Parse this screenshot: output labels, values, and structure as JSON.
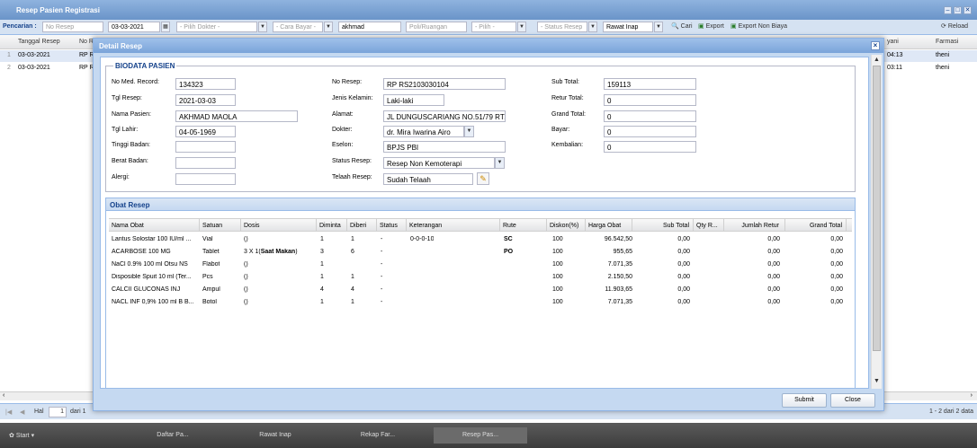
{
  "bg": {
    "title": "Resep Pasien Registrasi",
    "search_label": "Pencarian :",
    "search_placeholder": "No Resep",
    "date_value": "03-03-2021",
    "dokter_placeholder": "- Pilih Dokter -",
    "carabayar_placeholder": "- Cara Bayar -",
    "name_value": "akhmad",
    "poli_placeholder": "Poli/Ruangan",
    "pilih_placeholder": "- Pilih -",
    "status_placeholder": "- Status Resep",
    "rawat_value": "Rawat Inap",
    "cari_label": "Cari",
    "export_label": "Export",
    "export_non_label": "Export Non Biaya",
    "reload_label": "Reload",
    "columns": [
      "Tanggal Resep",
      "No R",
      "yani",
      "Farmasi"
    ],
    "rows": [
      {
        "num": "1",
        "date": "03-03-2021",
        "nor": "RP R",
        "time": "04:13",
        "farmasi": "theni"
      },
      {
        "num": "2",
        "date": "03-03-2021",
        "nor": "RP R",
        "time": "03:11",
        "farmasi": "theni"
      }
    ],
    "pager_hal": "Hal",
    "pager_page": "1",
    "pager_of": "dari 1",
    "pager_info": "1 - 2 dari 2 data"
  },
  "taskbar": {
    "start": "Start",
    "tasks": [
      "Daftar Pa...",
      "Rawat Inap",
      "Rekap Far...",
      "Resep Pas..."
    ]
  },
  "dialog": {
    "title": "Detail Resep",
    "submit": "Submit",
    "close": "Close"
  },
  "bio": {
    "legend": "BIODATA PASIEN",
    "labels": {
      "nomed": "No Med. Record:",
      "tglresep": "Tgl Resep:",
      "nama": "Nama Pasien:",
      "tgllahir": "Tgl Lahir:",
      "tinggi": "Tinggi Badan:",
      "berat": "Berat Badan:",
      "alergi": "Alergi:",
      "noresep": "No Resep:",
      "jk": "Jenis Kelamin:",
      "alamat": "Alamat:",
      "dokter": "Dokter:",
      "eselon": "Eselon:",
      "statusresep": "Status Resep:",
      "telaah": "Telaah Resep:",
      "subtotal": "Sub Total:",
      "retur": "Retur Total:",
      "grand": "Grand Total:",
      "bayar": "Bayar:",
      "kembalian": "Kembalian:"
    },
    "values": {
      "nomed": "134323",
      "tglresep": "2021-03-03",
      "nama": "AKHMAD MAOLA",
      "tgllahir": "04-05-1969",
      "tinggi": "",
      "berat": "",
      "alergi": "",
      "noresep": "RP RS2103030104",
      "jk": "Laki-laki",
      "alamat": "JL DUNGUSCARIANG NO.51/79 RT/",
      "dokter": "dr. Mira Iwarina Airo",
      "eselon": "BPJS PBI",
      "statusresep": "Resep Non Kemoterapi",
      "telaah": "Sudah Telaah",
      "subtotal": "159113",
      "retur": "0",
      "grand": "0",
      "bayar": "0",
      "kembalian": "0"
    }
  },
  "obat": {
    "title": "Obat Resep",
    "columns": [
      "Nama Obat",
      "Satuan",
      "Dosis",
      "Diminta",
      "Diberi",
      "Status",
      "Keterangan",
      "Rute",
      "Diskon(%)",
      "Harga Obat",
      "Sub Total",
      "Qty R...",
      "Jumlah Retur",
      "Grand Total"
    ],
    "rows": [
      {
        "nama": "Lantus Solostar 100 IU/ml ...",
        "satuan": "Vial",
        "dosis_a": "()",
        "dosis_b": "",
        "diminta": "1",
        "diberi": "1",
        "status": "-",
        "ket": "0-0-0-10",
        "rute": "SC",
        "diskon": "100",
        "harga": "96.542,50",
        "sub": "0,00",
        "qty": "",
        "retur": "0,00",
        "grand": "0,00"
      },
      {
        "nama": "ACARBOSE 100 MG",
        "satuan": "Tablet",
        "dosis_a": "3 X 1(",
        "dosis_b": "Saat Makan",
        "dosis_c": ")",
        "diminta": "3",
        "diberi": "6",
        "status": "-",
        "ket": "",
        "rute": "PO",
        "diskon": "100",
        "harga": "955,65",
        "sub": "0,00",
        "qty": "",
        "retur": "0,00",
        "grand": "0,00"
      },
      {
        "nama": "NaCl 0.9% 100 ml Otsu NS",
        "satuan": "Flabot",
        "dosis_a": "()",
        "dosis_b": "",
        "diminta": "1",
        "diberi": "",
        "status": "-",
        "ket": "",
        "rute": "",
        "diskon": "100",
        "harga": "7.071,35",
        "sub": "0,00",
        "qty": "",
        "retur": "0,00",
        "grand": "0,00"
      },
      {
        "nama": "Disposible Spuit 10 ml (Ter...",
        "satuan": "Pcs",
        "dosis_a": "()",
        "dosis_b": "",
        "diminta": "1",
        "diberi": "1",
        "status": "-",
        "ket": "",
        "rute": "",
        "diskon": "100",
        "harga": "2.150,50",
        "sub": "0,00",
        "qty": "",
        "retur": "0,00",
        "grand": "0,00"
      },
      {
        "nama": "CALCII GLUCONAS INJ",
        "satuan": "Ampul",
        "dosis_a": "()",
        "dosis_b": "",
        "diminta": "4",
        "diberi": "4",
        "status": "-",
        "ket": "",
        "rute": "",
        "diskon": "100",
        "harga": "11.903,65",
        "sub": "0,00",
        "qty": "",
        "retur": "0,00",
        "grand": "0,00"
      },
      {
        "nama": "NACL INF 0,9% 100 ml B B...",
        "satuan": "Botol",
        "dosis_a": "()",
        "dosis_b": "",
        "diminta": "1",
        "diberi": "1",
        "status": "-",
        "ket": "",
        "rute": "",
        "diskon": "100",
        "harga": "7.071,35",
        "sub": "0,00",
        "qty": "",
        "retur": "0,00",
        "grand": "0,00"
      }
    ]
  }
}
